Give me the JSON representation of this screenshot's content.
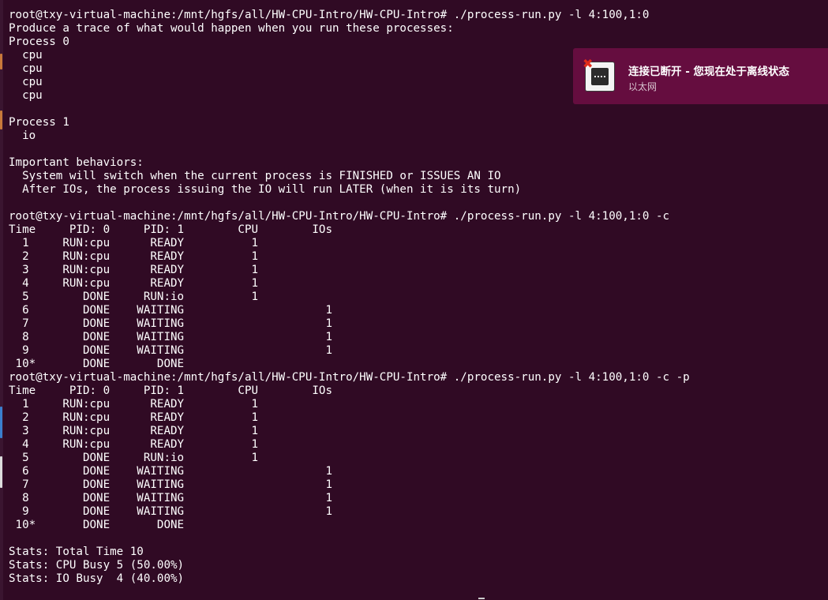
{
  "terminal": {
    "lines": [
      "root@txy-virtual-machine:/mnt/hgfs/all/HW-CPU-Intro/HW-CPU-Intro# ./process-run.py -l 4:100,1:0",
      "Produce a trace of what would happen when you run these processes:",
      "Process 0",
      "  cpu",
      "  cpu",
      "  cpu",
      "  cpu",
      "",
      "Process 1",
      "  io",
      "",
      "Important behaviors:",
      "  System will switch when the current process is FINISHED or ISSUES AN IO",
      "  After IOs, the process issuing the IO will run LATER (when it is its turn)",
      "",
      "root@txy-virtual-machine:/mnt/hgfs/all/HW-CPU-Intro/HW-CPU-Intro# ./process-run.py -l 4:100,1:0 -c",
      "Time     PID: 0     PID: 1        CPU        IOs",
      "  1     RUN:cpu      READY          1",
      "  2     RUN:cpu      READY          1",
      "  3     RUN:cpu      READY          1",
      "  4     RUN:cpu      READY          1",
      "  5        DONE     RUN:io          1",
      "  6        DONE    WAITING                     1",
      "  7        DONE    WAITING                     1",
      "  8        DONE    WAITING                     1",
      "  9        DONE    WAITING                     1",
      " 10*       DONE       DONE",
      "root@txy-virtual-machine:/mnt/hgfs/all/HW-CPU-Intro/HW-CPU-Intro# ./process-run.py -l 4:100,1:0 -c -p",
      "Time     PID: 0     PID: 1        CPU        IOs",
      "  1     RUN:cpu      READY          1",
      "  2     RUN:cpu      READY          1",
      "  3     RUN:cpu      READY          1",
      "  4     RUN:cpu      READY          1",
      "  5        DONE     RUN:io          1",
      "  6        DONE    WAITING                     1",
      "  7        DONE    WAITING                     1",
      "  8        DONE    WAITING                     1",
      "  9        DONE    WAITING                     1",
      " 10*       DONE       DONE",
      "",
      "Stats: Total Time 10",
      "Stats: CPU Busy 5 (50.00%)",
      "Stats: IO Busy  4 (40.00%)"
    ]
  },
  "notification": {
    "title": "连接已断开 - 您现在处于离线状态",
    "body": "以太网",
    "icon": "network-wired-disconnected-icon",
    "error_badge": "✖"
  },
  "colors": {
    "terminal_bg": "#300a24",
    "terminal_fg": "#ffffff",
    "notification_bg": "#650d3f",
    "error_red": "#e02c1b"
  }
}
